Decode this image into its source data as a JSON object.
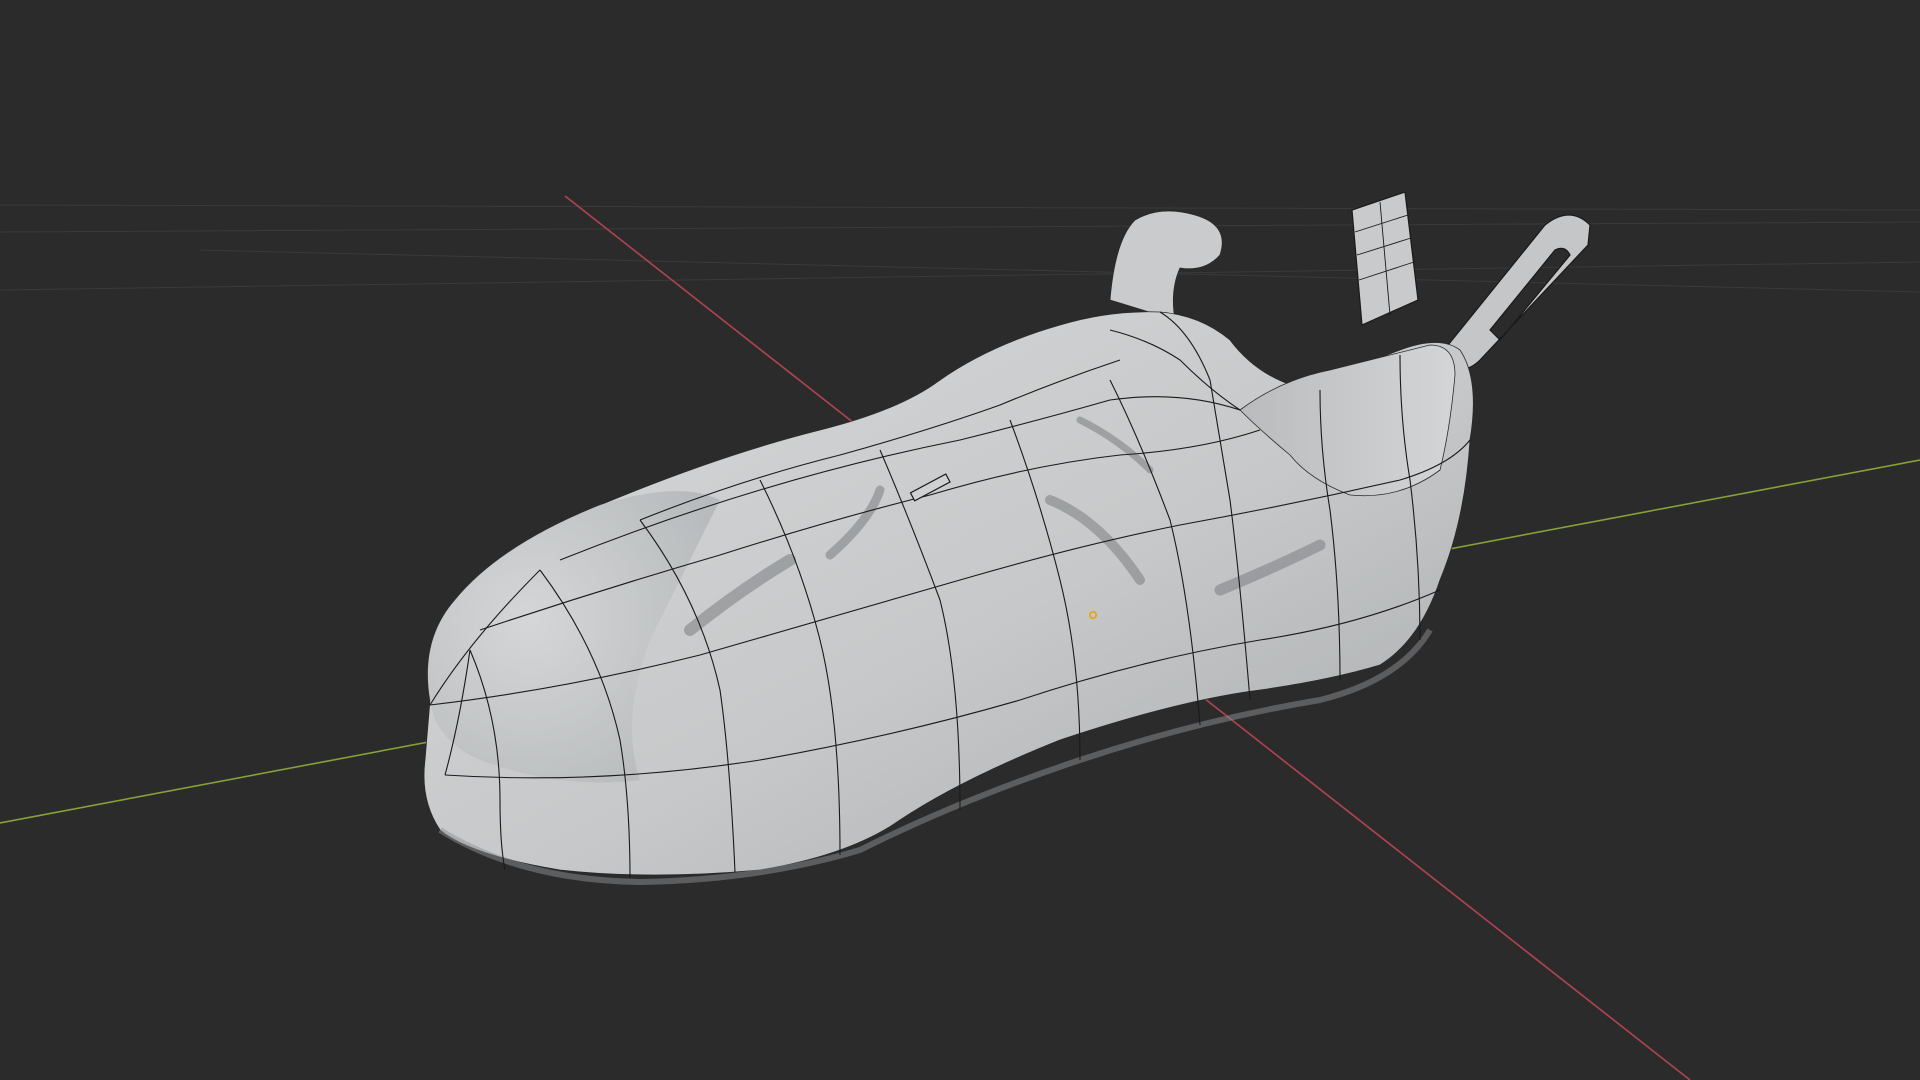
{
  "viewport": {
    "background_color": "#2b2b2b",
    "grid_color": "#3a3a3a",
    "x_axis_color": "#c9485a",
    "y_axis_color": "#8fae3a",
    "mesh_fill_color": "#c9cbcc",
    "mesh_shadow_color": "#8d9093",
    "wire_color": "#1a1a1a",
    "origin_color": "#e8a400"
  },
  "scene": {
    "object": "shoe-mesh",
    "shading": "solid",
    "overlays": "wireframe",
    "show_axes": true,
    "show_floor_grid": true
  }
}
